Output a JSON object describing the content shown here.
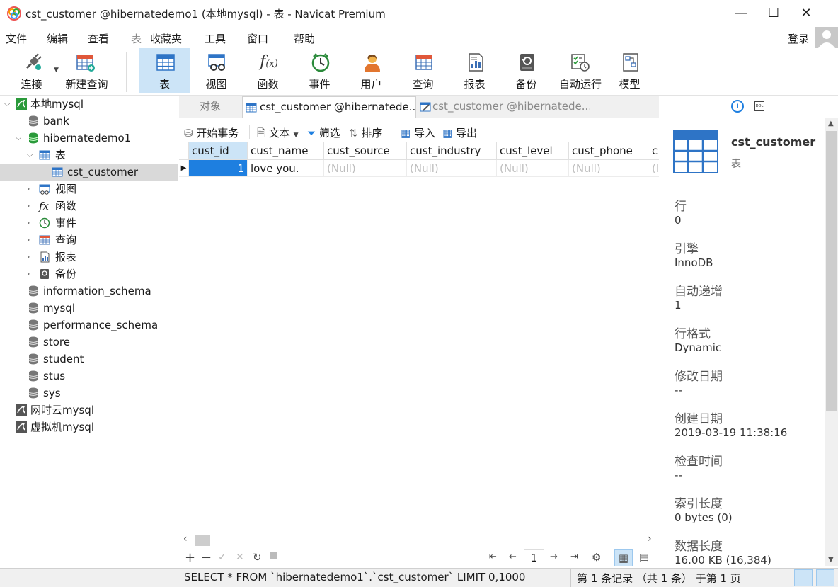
{
  "window": {
    "title": "cst_customer @hibernatedemo1 (本地mysql) - 表 - Navicat Premium",
    "min_glyph": "—",
    "max_glyph": "☐",
    "close_glyph": "✕"
  },
  "menu": [
    "文件",
    "编辑",
    "查看",
    "表",
    "收藏夹",
    "工具",
    "窗口",
    "帮助"
  ],
  "login": "登录",
  "toolbar": [
    {
      "label": "连接",
      "icon": "plug-icon"
    },
    {
      "label": "新建查询",
      "icon": "new-query-icon"
    },
    {
      "label": "表",
      "icon": "table-icon"
    },
    {
      "label": "视图",
      "icon": "view-icon"
    },
    {
      "label": "函数",
      "icon": "function-icon"
    },
    {
      "label": "事件",
      "icon": "clock-icon"
    },
    {
      "label": "用户",
      "icon": "user-icon"
    },
    {
      "label": "查询",
      "icon": "query-icon"
    },
    {
      "label": "报表",
      "icon": "report-icon"
    },
    {
      "label": "备份",
      "icon": "backup-icon"
    },
    {
      "label": "自动运行",
      "icon": "automation-icon"
    },
    {
      "label": "模型",
      "icon": "model-icon"
    }
  ],
  "tree": [
    {
      "label": "本地mysql",
      "icon": "mysql-connection-icon"
    },
    {
      "label": "bank",
      "icon": "database-icon"
    },
    {
      "label": "hibernatedemo1",
      "icon": "database-icon"
    },
    {
      "label": "表",
      "icon": "table-folder-icon"
    },
    {
      "label": "cst_customer",
      "icon": "table-icon"
    },
    {
      "label": "视图",
      "icon": "view-folder-icon"
    },
    {
      "label": "函数",
      "icon": "function-folder-icon"
    },
    {
      "label": "事件",
      "icon": "event-folder-icon"
    },
    {
      "label": "查询",
      "icon": "query-folder-icon"
    },
    {
      "label": "报表",
      "icon": "report-folder-icon"
    },
    {
      "label": "备份",
      "icon": "backup-folder-icon"
    },
    {
      "label": "information_schema",
      "icon": "database-icon"
    },
    {
      "label": "mysql",
      "icon": "database-icon"
    },
    {
      "label": "performance_schema",
      "icon": "database-icon"
    },
    {
      "label": "store",
      "icon": "database-icon"
    },
    {
      "label": "student",
      "icon": "database-icon"
    },
    {
      "label": "stus",
      "icon": "database-icon"
    },
    {
      "label": "sys",
      "icon": "database-icon"
    },
    {
      "label": "网时云mysql",
      "icon": "mysql-connection-icon"
    },
    {
      "label": "虚拟机mysql",
      "icon": "mysql-connection-icon"
    }
  ],
  "tabs": [
    {
      "label": "对象"
    },
    {
      "label": "cst_customer @hibernatede..."
    },
    {
      "label": "cst_customer @hibernatede..."
    }
  ],
  "data_toolbar": {
    "begin_tx": "开始事务",
    "text": "文本",
    "filter": "筛选",
    "sort": "排序",
    "import": "导入",
    "export": "导出"
  },
  "grid": {
    "columns": [
      "cust_id",
      "cust_name",
      "cust_source",
      "cust_industry",
      "cust_level",
      "cust_phone",
      "c"
    ],
    "rows": [
      [
        "1",
        "love you.",
        "(Null)",
        "(Null)",
        "(Null)",
        "(Null)",
        "(I"
      ]
    ]
  },
  "nav": {
    "page": "1"
  },
  "info_panel": {
    "table_name": "cst_customer",
    "table_type": "表",
    "fields": [
      {
        "label": "行",
        "value": "0"
      },
      {
        "label": "引擎",
        "value": "InnoDB"
      },
      {
        "label": "自动递增",
        "value": "1"
      },
      {
        "label": "行格式",
        "value": "Dynamic"
      },
      {
        "label": "修改日期",
        "value": "--"
      },
      {
        "label": "创建日期",
        "value": "2019-03-19 11:38:16"
      },
      {
        "label": "检查时间",
        "value": "--"
      },
      {
        "label": "索引长度",
        "value": "0 bytes (0)"
      },
      {
        "label": "数据长度",
        "value": "16.00 KB (16,384)"
      }
    ]
  },
  "status": {
    "sql": "SELECT * FROM `hibernatedemo1`.`cst_customer` LIMIT 0,1000",
    "records": "第 1 条记录 （共 1 条） 于第 1 页"
  },
  "colors": {
    "accent": "#0078d7",
    "selection_blue": "#1e7fe0",
    "active_tool": "#cce4f7",
    "tree_selected": "#d9d9d9"
  }
}
